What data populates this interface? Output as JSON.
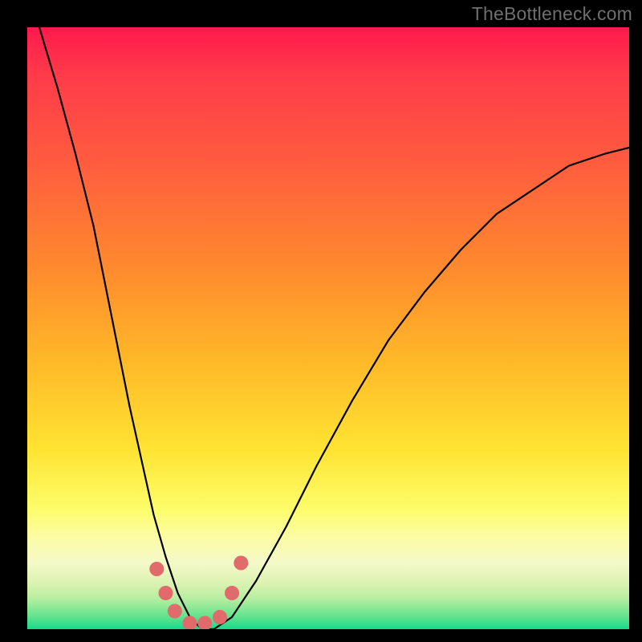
{
  "watermark": "TheBottleneck.com",
  "chart_data": {
    "type": "line",
    "title": "",
    "xlabel": "",
    "ylabel": "",
    "xlim": [
      0,
      100
    ],
    "ylim": [
      0,
      100
    ],
    "series": [
      {
        "name": "bottleneck-curve",
        "x": [
          2,
          5,
          8,
          11,
          13,
          15,
          17,
          19,
          21,
          23,
          25,
          27,
          29,
          31,
          34,
          38,
          43,
          48,
          54,
          60,
          66,
          72,
          78,
          84,
          90,
          96,
          100
        ],
        "y": [
          100,
          90,
          79,
          67,
          57,
          47,
          37,
          28,
          19,
          12,
          6,
          2,
          0,
          0,
          2,
          8,
          17,
          27,
          38,
          48,
          56,
          63,
          69,
          73,
          77,
          79,
          80
        ]
      }
    ],
    "markers": {
      "name": "highlight-beads",
      "color": "#e16a6a",
      "points": [
        {
          "x": 21.5,
          "y": 10
        },
        {
          "x": 23.0,
          "y": 6
        },
        {
          "x": 24.5,
          "y": 3
        },
        {
          "x": 27.0,
          "y": 1
        },
        {
          "x": 29.5,
          "y": 1
        },
        {
          "x": 32.0,
          "y": 2
        },
        {
          "x": 34.0,
          "y": 6
        },
        {
          "x": 35.5,
          "y": 11
        }
      ]
    },
    "background_gradient": {
      "direction": "vertical",
      "stops": [
        {
          "pos": 0.0,
          "color": "#ff1a4d"
        },
        {
          "pos": 0.4,
          "color": "#ff8a2e"
        },
        {
          "pos": 0.7,
          "color": "#ffe332"
        },
        {
          "pos": 0.85,
          "color": "#fcfca8"
        },
        {
          "pos": 1.0,
          "color": "#16db8b"
        }
      ]
    }
  }
}
